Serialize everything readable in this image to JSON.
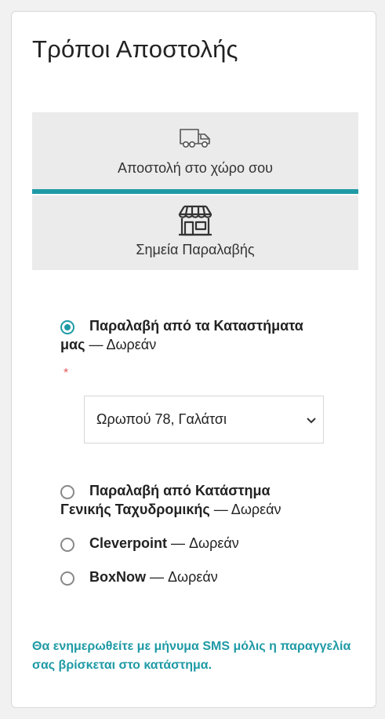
{
  "page": {
    "title": "Τρόποι Αποστολής"
  },
  "tabs": [
    {
      "label": "Αποστολή στο χώρο σου",
      "icon": "truck-icon",
      "active": true
    },
    {
      "label": "Σημεία Παραλαβής",
      "icon": "store-icon",
      "active": false
    }
  ],
  "options": [
    {
      "title_line1": "Παραλαβή από τα Καταστήματα",
      "title_line2": "μας",
      "price": " — Δωρεάν",
      "selected": true,
      "required_mark": "*"
    },
    {
      "title_line1": "Παραλαβή από Κατάστημα",
      "title_line2": "Γενικής Ταχυδρομικής",
      "price": " — Δωρεάν",
      "selected": false
    },
    {
      "title": "Cleverpoint",
      "price": " — Δωρεάν",
      "selected": false
    },
    {
      "title": "BoxNow",
      "price": " — Δωρεάν",
      "selected": false
    }
  ],
  "store_select": {
    "value": "Ωρωπού 78, Γαλάτσι"
  },
  "note": "Θα ενημερωθείτε με μήνυμα SMS μόλις η παραγγελία σας βρίσκεται στο κατάστημα.",
  "colors": {
    "accent": "#1e9aa5",
    "tab_bg": "#ebebeb",
    "required": "#e05a5a"
  }
}
